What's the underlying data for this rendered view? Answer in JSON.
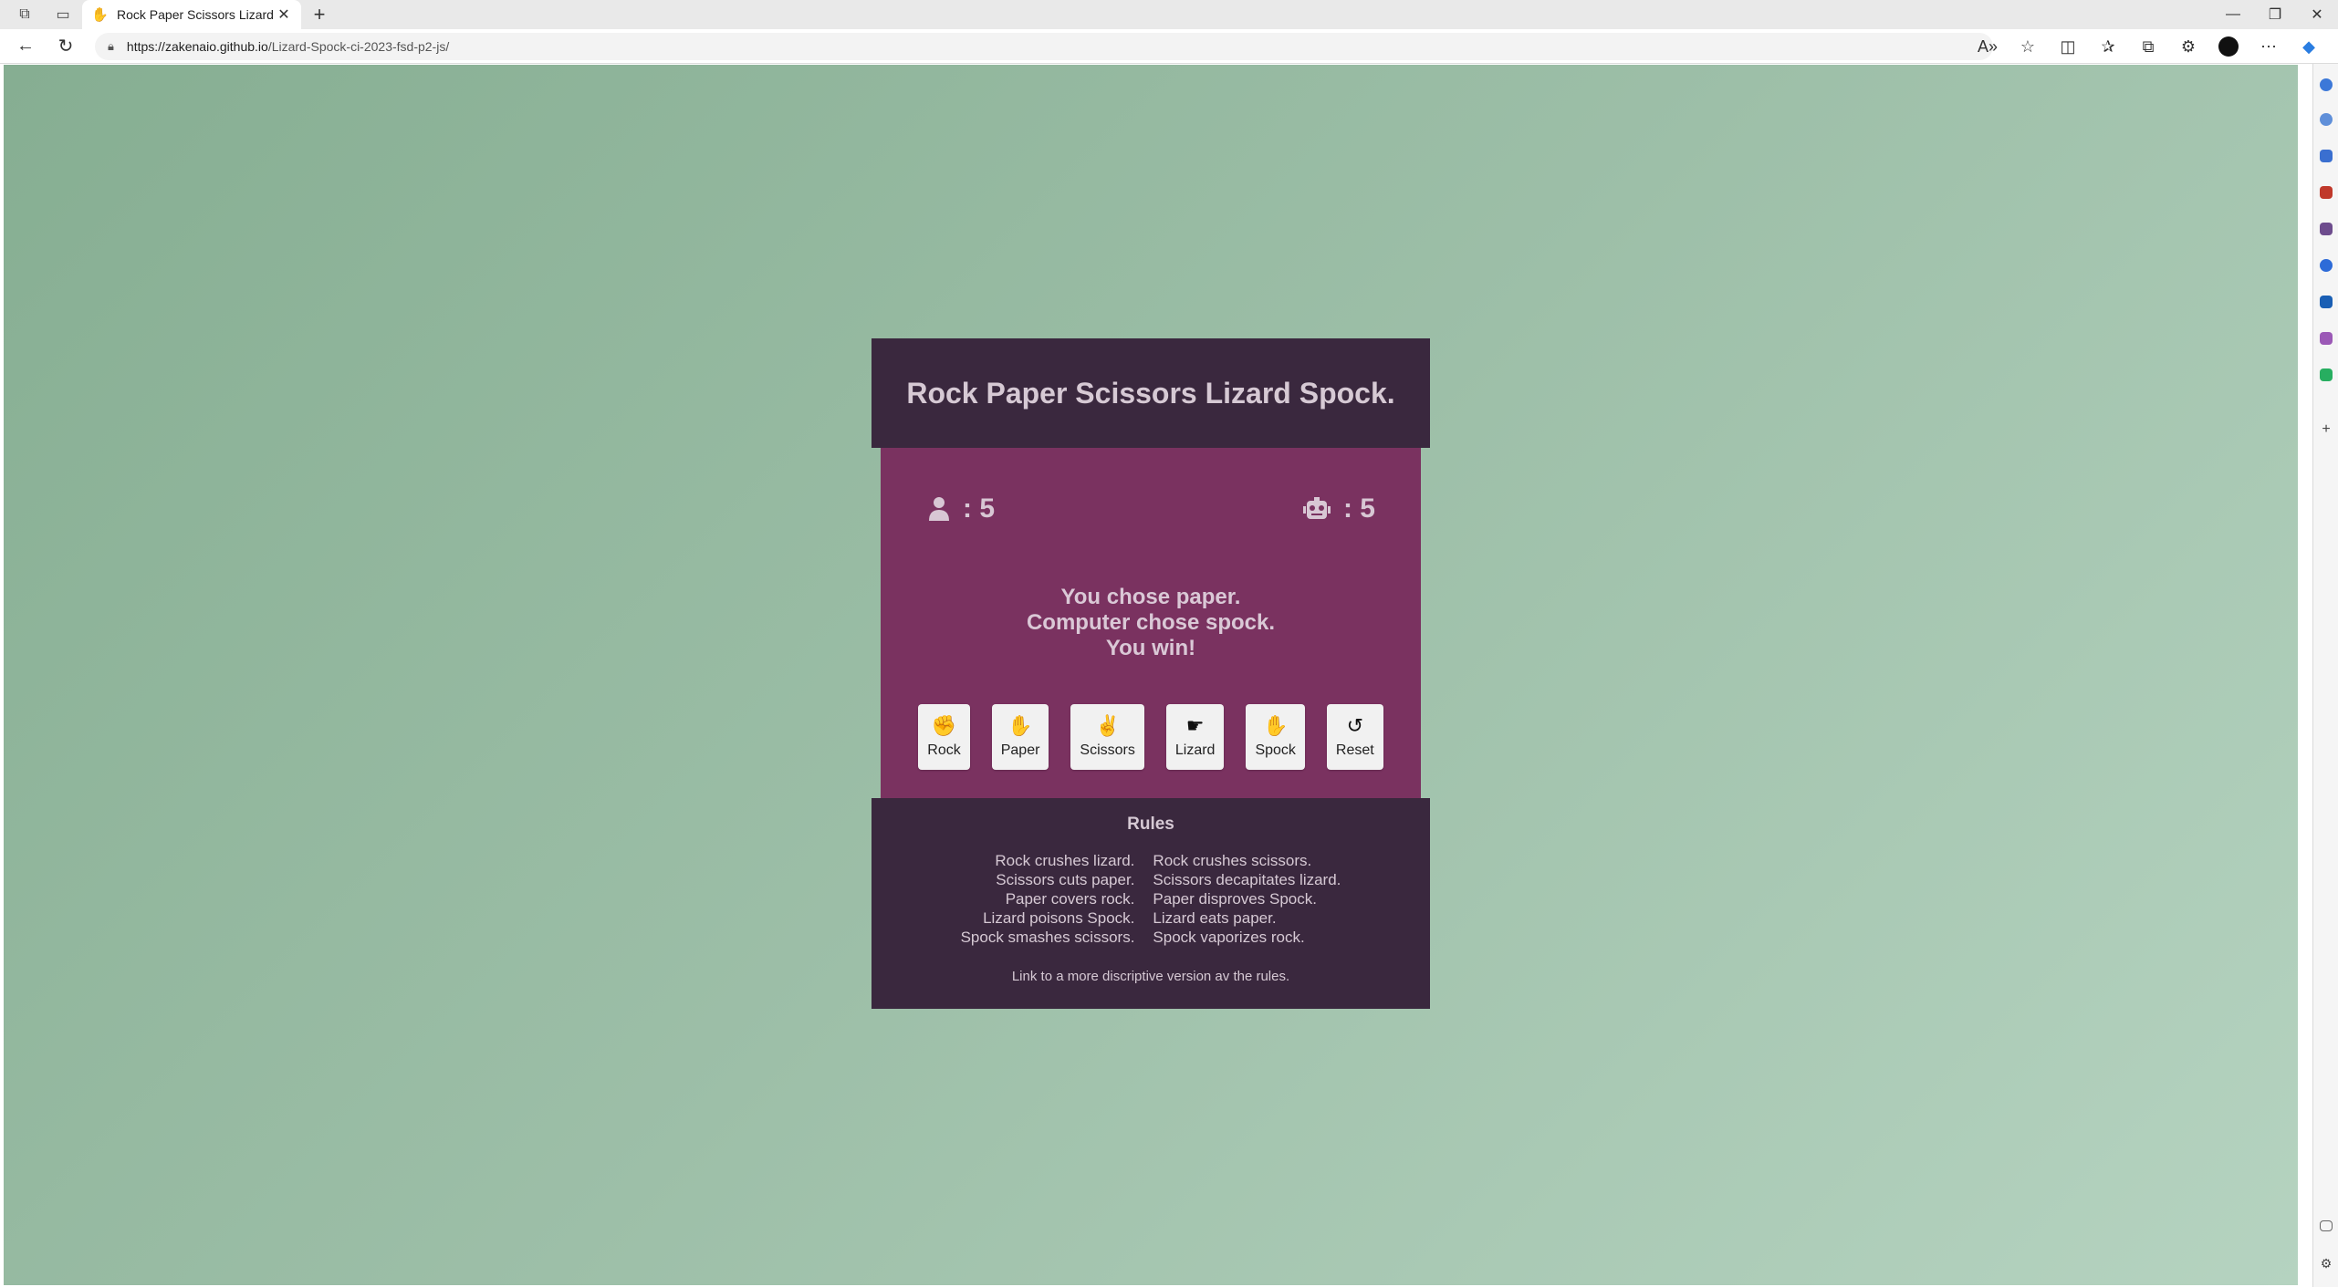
{
  "browser": {
    "tab_title": "Rock Paper Scissors Lizard Spock",
    "url_host": "https://zakenaio.github.io",
    "url_path": "/Lizard-Spock-ci-2023-fsd-p2-js/"
  },
  "game": {
    "title": "Rock Paper Scissors Lizard Spock.",
    "player_score": ": 5",
    "computer_score": ": 5",
    "message_line1": "You chose paper.",
    "message_line2": "Computer chose spock.",
    "message_line3": "You win!",
    "buttons": [
      {
        "label": "Rock",
        "icon": "hand-rock-icon"
      },
      {
        "label": "Paper",
        "icon": "hand-paper-icon"
      },
      {
        "label": "Scissors",
        "icon": "hand-scissors-icon"
      },
      {
        "label": "Lizard",
        "icon": "hand-lizard-icon"
      },
      {
        "label": "Spock",
        "icon": "hand-spock-icon"
      },
      {
        "label": "Reset",
        "icon": "reset-icon"
      }
    ]
  },
  "rules": {
    "heading": "Rules",
    "left": [
      "Rock crushes lizard.",
      "Scissors cuts paper.",
      "Paper covers rock.",
      "Lizard poisons Spock.",
      "Spock smashes scissors."
    ],
    "right": [
      "Rock crushes scissors.",
      "Scissors decapitates lizard.",
      "Paper disproves Spock.",
      "Lizard eats paper.",
      "Spock vaporizes rock."
    ],
    "link_text": "Link to a more discriptive version av the rules."
  },
  "colors": {
    "header_bg": "#3a283e",
    "board_bg": "#7a3260",
    "page_gradient_start": "#86ae92",
    "page_gradient_end": "#b5d3c0"
  }
}
